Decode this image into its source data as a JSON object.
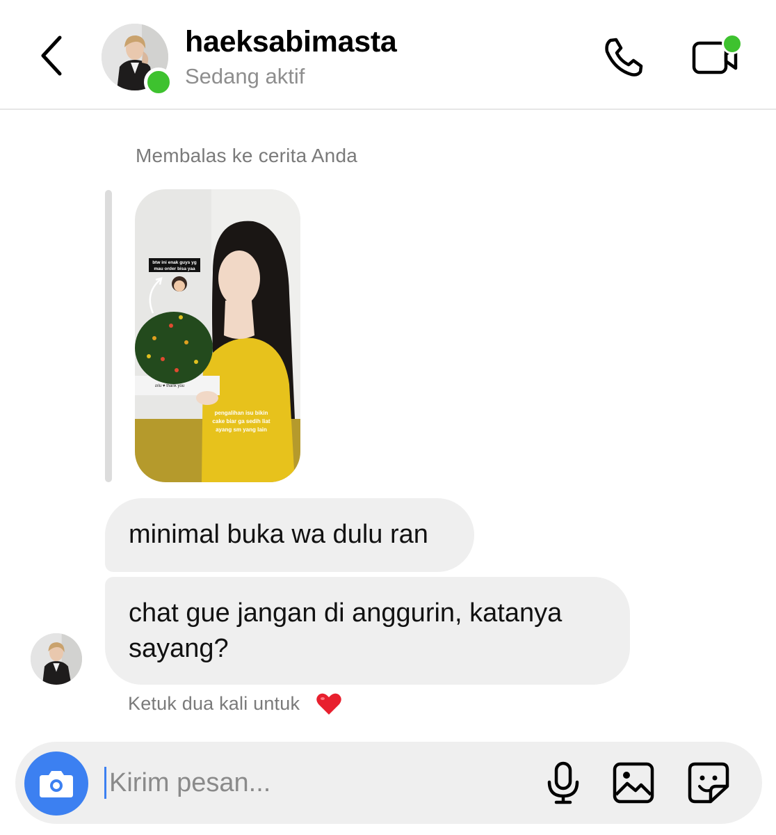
{
  "header": {
    "username": "haeksabimasta",
    "status": "Sedang aktif"
  },
  "thread": {
    "reply_label": "Membalas ke cerita Anda",
    "story": {
      "caption_top_1": "btw ini enak guys yg",
      "caption_top_2": "mau order bisa yaa",
      "cake_text": "ƨılu ♥ thank you",
      "caption_bottom_1": "pengalihan isu bikin",
      "caption_bottom_2": "cake biar ga sedih liat",
      "caption_bottom_3": "ayang sm yang lain"
    },
    "messages": [
      {
        "text": "minimal buka wa dulu ran"
      },
      {
        "text": "chat gue jangan di anggurin, katanya sayang?"
      }
    ],
    "tap_hint": "Ketuk dua kali untuk"
  },
  "composer": {
    "placeholder": "Kirim pesan..."
  },
  "colors": {
    "active": "#3ec22f",
    "accent": "#3c80f1",
    "bubble": "#efefef",
    "heart": "#e8202e"
  },
  "icons": [
    "back-chevron-icon",
    "phone-icon",
    "video-icon",
    "camera-icon",
    "microphone-icon",
    "gallery-icon",
    "sticker-icon",
    "heart-icon"
  ]
}
